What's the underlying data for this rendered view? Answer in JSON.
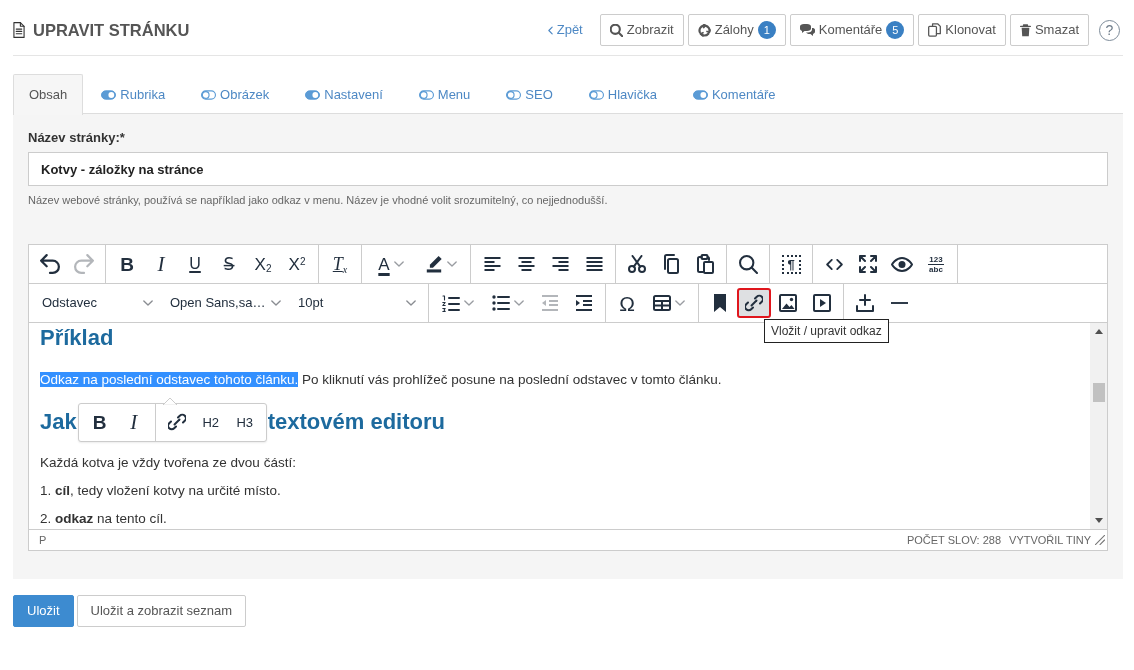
{
  "header": {
    "title": "UPRAVIT STRÁNKU",
    "back_link": "Zpět",
    "buttons": [
      {
        "label": "Zobrazit"
      },
      {
        "label": "Zálohy",
        "badge": "1"
      },
      {
        "label": "Komentáře",
        "badge": "5"
      },
      {
        "label": "Klonovat"
      },
      {
        "label": "Smazat"
      }
    ],
    "help": "?"
  },
  "tabs": [
    {
      "label": "Obsah",
      "selected": true,
      "kind": "plain"
    },
    {
      "label": "Rubrika",
      "selected": false,
      "kind": "toggle",
      "on": true
    },
    {
      "label": "Obrázek",
      "selected": false,
      "kind": "toggle",
      "on": false
    },
    {
      "label": "Nastavení",
      "selected": false,
      "kind": "toggle",
      "on": true
    },
    {
      "label": "Menu",
      "selected": false,
      "kind": "toggle",
      "on": false
    },
    {
      "label": "SEO",
      "selected": false,
      "kind": "toggle",
      "on": false
    },
    {
      "label": "Hlavička",
      "selected": false,
      "kind": "toggle",
      "on": false
    },
    {
      "label": "Komentáře",
      "selected": false,
      "kind": "toggle",
      "on": true
    }
  ],
  "form": {
    "label": "Název stránky:*",
    "value": "Kotvy - záložky na stránce",
    "hint": "Název webové stránky, používá se například jako odkaz v menu. Název je vhodné volit srozumitelný, co nejjednodušší."
  },
  "editor": {
    "toolbar": {
      "row_1": [
        [
          {
            "kind": "icon",
            "split": false,
            "disabled": false,
            "active": false
          },
          {
            "kind": "icon",
            "split": false,
            "disabled": true,
            "active": false
          }
        ],
        [
          {
            "kind": "glyph",
            "label": "B",
            "split": false,
            "disabled": false,
            "active": false
          },
          {
            "kind": "glyph",
            "label": "I",
            "split": false,
            "disabled": false,
            "active": false
          },
          {
            "kind": "glyph",
            "label": "U",
            "split": false,
            "disabled": false,
            "active": false
          },
          {
            "kind": "glyph",
            "label": "S̶",
            "split": false,
            "disabled": false,
            "active": false
          },
          {
            "kind": "glyph",
            "label": "X$_{2}$",
            "split": false,
            "disabled": false,
            "active": false
          },
          {
            "kind": "glyph",
            "label": "X$^{2}$",
            "split": false,
            "disabled": false,
            "active": false
          }
        ],
        [
          {
            "kind": "glyph",
            "label": "T$_{x}$",
            "split": false,
            "disabled": false,
            "active": false
          }
        ],
        [
          {
            "kind": "glyph",
            "label": "A",
            "split": true,
            "disabled": false,
            "active": false
          },
          {
            "kind": "icon",
            "split": true,
            "disabled": false,
            "active": false
          }
        ],
        [
          {
            "kind": "icon",
            "split": false,
            "disabled": false,
            "active": false
          },
          {
            "kind": "icon",
            "split": false,
            "disabled": false,
            "active": false
          },
          {
            "kind": "icon",
            "split": false,
            "disabled": false,
            "active": false
          },
          {
            "kind": "icon",
            "split": false,
            "disabled": false,
            "active": false
          }
        ],
        [
          {
            "kind": "icon",
            "split": false,
            "disabled": false,
            "active": false
          },
          {
            "kind": "icon",
            "split": false,
            "disabled": false,
            "active": false
          },
          {
            "kind": "icon",
            "split": false,
            "disabled": false,
            "active": false
          }
        ],
        [
          {
            "kind": "icon",
            "split": false,
            "disabled": false,
            "active": false
          }
        ],
        [
          {
            "kind": "glyph",
            "label": "¶",
            "split": false,
            "disabled": false,
            "active": false
          }
        ],
        [
          {
            "kind": "icon",
            "split": false,
            "disabled": false,
            "active": false
          },
          {
            "kind": "icon",
            "split": false,
            "disabled": false,
            "active": false
          },
          {
            "kind": "icon",
            "split": false,
            "disabled": false,
            "active": false
          },
          {
            "kind": "glyph",
            "label": "123",
            "sublabel": "abc",
            "split": false,
            "disabled": false,
            "active": false
          }
        ]
      ],
      "selects": [
        {
          "value": "Odstavec"
        },
        {
          "value": "Open Sans,sa…"
        },
        {
          "value": "10pt"
        }
      ],
      "row_2": [
        [
          {
            "kind": "icon",
            "split": true,
            "disabled": false,
            "active": false
          },
          {
            "kind": "icon",
            "split": true,
            "disabled": false,
            "active": false
          },
          {
            "kind": "icon",
            "split": false,
            "disabled": true,
            "active": false
          },
          {
            "kind": "icon",
            "split": false,
            "disabled": false,
            "active": false
          }
        ],
        [
          {
            "kind": "glyph",
            "label": "Ω",
            "split": false,
            "disabled": false,
            "active": false
          },
          {
            "kind": "icon",
            "split": true,
            "disabled": false,
            "active": false
          }
        ],
        [
          {
            "kind": "icon",
            "split": false,
            "disabled": false,
            "active": false
          },
          {
            "kind": "icon",
            "split": false,
            "disabled": false,
            "active": true
          },
          {
            "kind": "icon",
            "split": false,
            "disabled": false,
            "active": false
          },
          {
            "kind": "icon",
            "split": false,
            "disabled": false,
            "active": false
          }
        ],
        [
          {
            "kind": "icon",
            "split": false,
            "disabled": false,
            "active": false
          },
          {
            "kind": "icon",
            "split": false,
            "disabled": false,
            "active": false
          }
        ]
      ]
    },
    "tooltip": "Vložit / upravit odkaz",
    "content": [
      {
        "kind": "heading",
        "text": "Příklad"
      },
      {
        "kind": "selection_paragraph",
        "selected_text": "Odkaz na poslední odstavec tohoto článku.",
        "text": "Po kliknutí vás prohlížeč posune na poslední odstavec v tomto článku."
      },
      {
        "kind": "covered_heading",
        "before": "Jak",
        "quickbar": [
          [
            {
              "kind": "glyph",
              "label": "B"
            },
            {
              "kind": "glyph",
              "label": "I"
            }
          ],
          [
            {
              "kind": "icon"
            },
            {
              "kind": "glyph",
              "label": "H2"
            },
            {
              "kind": "glyph",
              "label": "H3"
            }
          ]
        ],
        "after": "textovém editoru"
      },
      {
        "kind": "paragraph",
        "text": "Každá kotva je vždy tvořena ze dvou částí:"
      },
      {
        "kind": "paragraph",
        "text": "1. **cíl**, tedy vložení kotvy na určité místo."
      },
      {
        "kind": "paragraph",
        "text": "2. **odkaz** na tento cíl."
      }
    ],
    "status_bar": {
      "path": "P",
      "word_count": "POČET SLOV: 288",
      "brand": "VYTVOŘIL TINY"
    }
  },
  "actions": [
    {
      "label": "Uložit",
      "kind": "primary"
    },
    {
      "label": "Uložit a zobrazit seznam",
      "kind": "secondary"
    }
  ]
}
